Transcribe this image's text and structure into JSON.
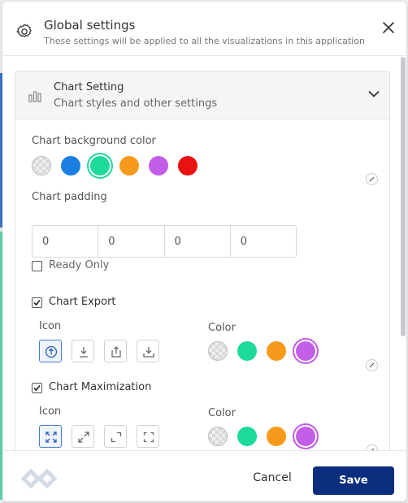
{
  "header": {
    "title": "Global settings",
    "subtitle": "These settings will be applied to all the visualizations in this application",
    "icon": "gear-icon",
    "close_icon": "close-icon"
  },
  "panel": {
    "title": "Chart Setting",
    "subtitle": "Chart styles and other settings",
    "expanded": true
  },
  "background": {
    "label": "Chart background color",
    "colors": [
      "transparent",
      "#1a7fe0",
      "#1ed99c",
      "#f79a1c",
      "#c25ee8",
      "#e81212"
    ],
    "selected": "#1ed99c"
  },
  "padding": {
    "label": "Chart padding",
    "values": [
      "0",
      "0",
      "0",
      "0"
    ]
  },
  "ready_only": {
    "label": "Ready Only",
    "checked": false
  },
  "export": {
    "label": "Chart Export",
    "checked": true,
    "icon_label": "Icon",
    "color_label": "Color",
    "icons": [
      "upload-circle-icon",
      "download-icon",
      "share-upload-icon",
      "download-tray-icon"
    ],
    "selected_icon": "upload-circle-icon",
    "colors": [
      "transparent",
      "#1ed99c",
      "#f79a1c",
      "#c25ee8"
    ],
    "selected_color": "#c25ee8"
  },
  "maximization": {
    "label": "Chart Maximization",
    "checked": true,
    "icon_label": "Icon",
    "color_label": "Color",
    "icons": [
      "expand-arrows-icon",
      "diagonal-expand-icon",
      "corner-expand-icon",
      "frame-corners-icon"
    ],
    "selected_icon": "expand-arrows-icon",
    "colors": [
      "transparent",
      "#1ed99c",
      "#f79a1c",
      "#c25ee8"
    ],
    "selected_color": "#c25ee8"
  },
  "footer": {
    "cancel_label": "Cancel",
    "save_label": "Save",
    "brand_color": "#0b2d7e"
  }
}
